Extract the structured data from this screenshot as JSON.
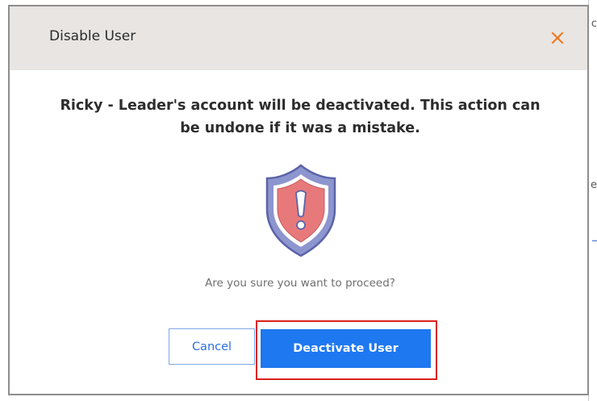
{
  "modal": {
    "title": "Disable User",
    "close_icon": "close-icon",
    "message": "Ricky - Leader's account will be deactivated. This action can be undone if it was a mistake.",
    "warning_icon": "shield-warning-icon",
    "confirm_text": "Are you sure you want to proceed?",
    "cancel_label": "Cancel",
    "deactivate_label": "Deactivate User"
  },
  "background_edge": {
    "glyphs": [
      "c",
      "e"
    ]
  },
  "colors": {
    "header_bg": "#e8e5e3",
    "accent": "#f07a22",
    "primary": "#1e78f0",
    "highlight": "#d9201c",
    "shield_fill": "#e8797a",
    "shield_border": "#6b73b6"
  }
}
